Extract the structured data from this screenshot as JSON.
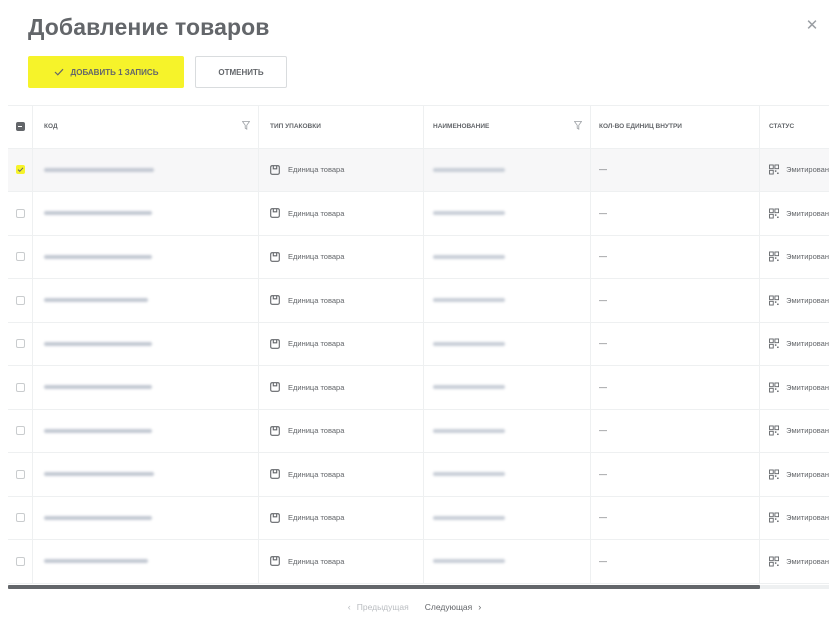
{
  "modal": {
    "title": "Добавление товаров",
    "close_icon": "close-icon"
  },
  "actions": {
    "add_label": "Добавить 1 запись",
    "add_icon": "check-icon",
    "cancel_label": "Отменить"
  },
  "table": {
    "columns": {
      "code": "Код",
      "pack_type": "Тип упаковки",
      "name": "Наименование",
      "qty_inside": "Кол-во единиц внутри",
      "status": "Статус"
    },
    "master_checkbox": "indeterminate",
    "rows": [
      {
        "selected": true,
        "pack_type": "Единица товара",
        "qty_inside": "—",
        "status": "Эмитирован"
      },
      {
        "selected": false,
        "pack_type": "Единица товара",
        "qty_inside": "—",
        "status": "Эмитирован"
      },
      {
        "selected": false,
        "pack_type": "Единица товара",
        "qty_inside": "—",
        "status": "Эмитирован"
      },
      {
        "selected": false,
        "pack_type": "Единица товара",
        "qty_inside": "—",
        "status": "Эмитирован"
      },
      {
        "selected": false,
        "pack_type": "Единица товара",
        "qty_inside": "—",
        "status": "Эмитирован"
      },
      {
        "selected": false,
        "pack_type": "Единица товара",
        "qty_inside": "—",
        "status": "Эмитирован"
      },
      {
        "selected": false,
        "pack_type": "Единица товара",
        "qty_inside": "—",
        "status": "Эмитирован"
      },
      {
        "selected": false,
        "pack_type": "Единица товара",
        "qty_inside": "—",
        "status": "Эмитирован"
      },
      {
        "selected": false,
        "pack_type": "Единица товара",
        "qty_inside": "—",
        "status": "Эмитирован"
      },
      {
        "selected": false,
        "pack_type": "Единица товара",
        "qty_inside": "—",
        "status": "Эмитирован"
      }
    ]
  },
  "pagination": {
    "prev_label": "Предыдущая",
    "next_label": "Следующая"
  },
  "colors": {
    "accent": "#f6f32a",
    "text": "#63666a",
    "muted": "#b9bcc0",
    "border": "#eef0f1"
  }
}
